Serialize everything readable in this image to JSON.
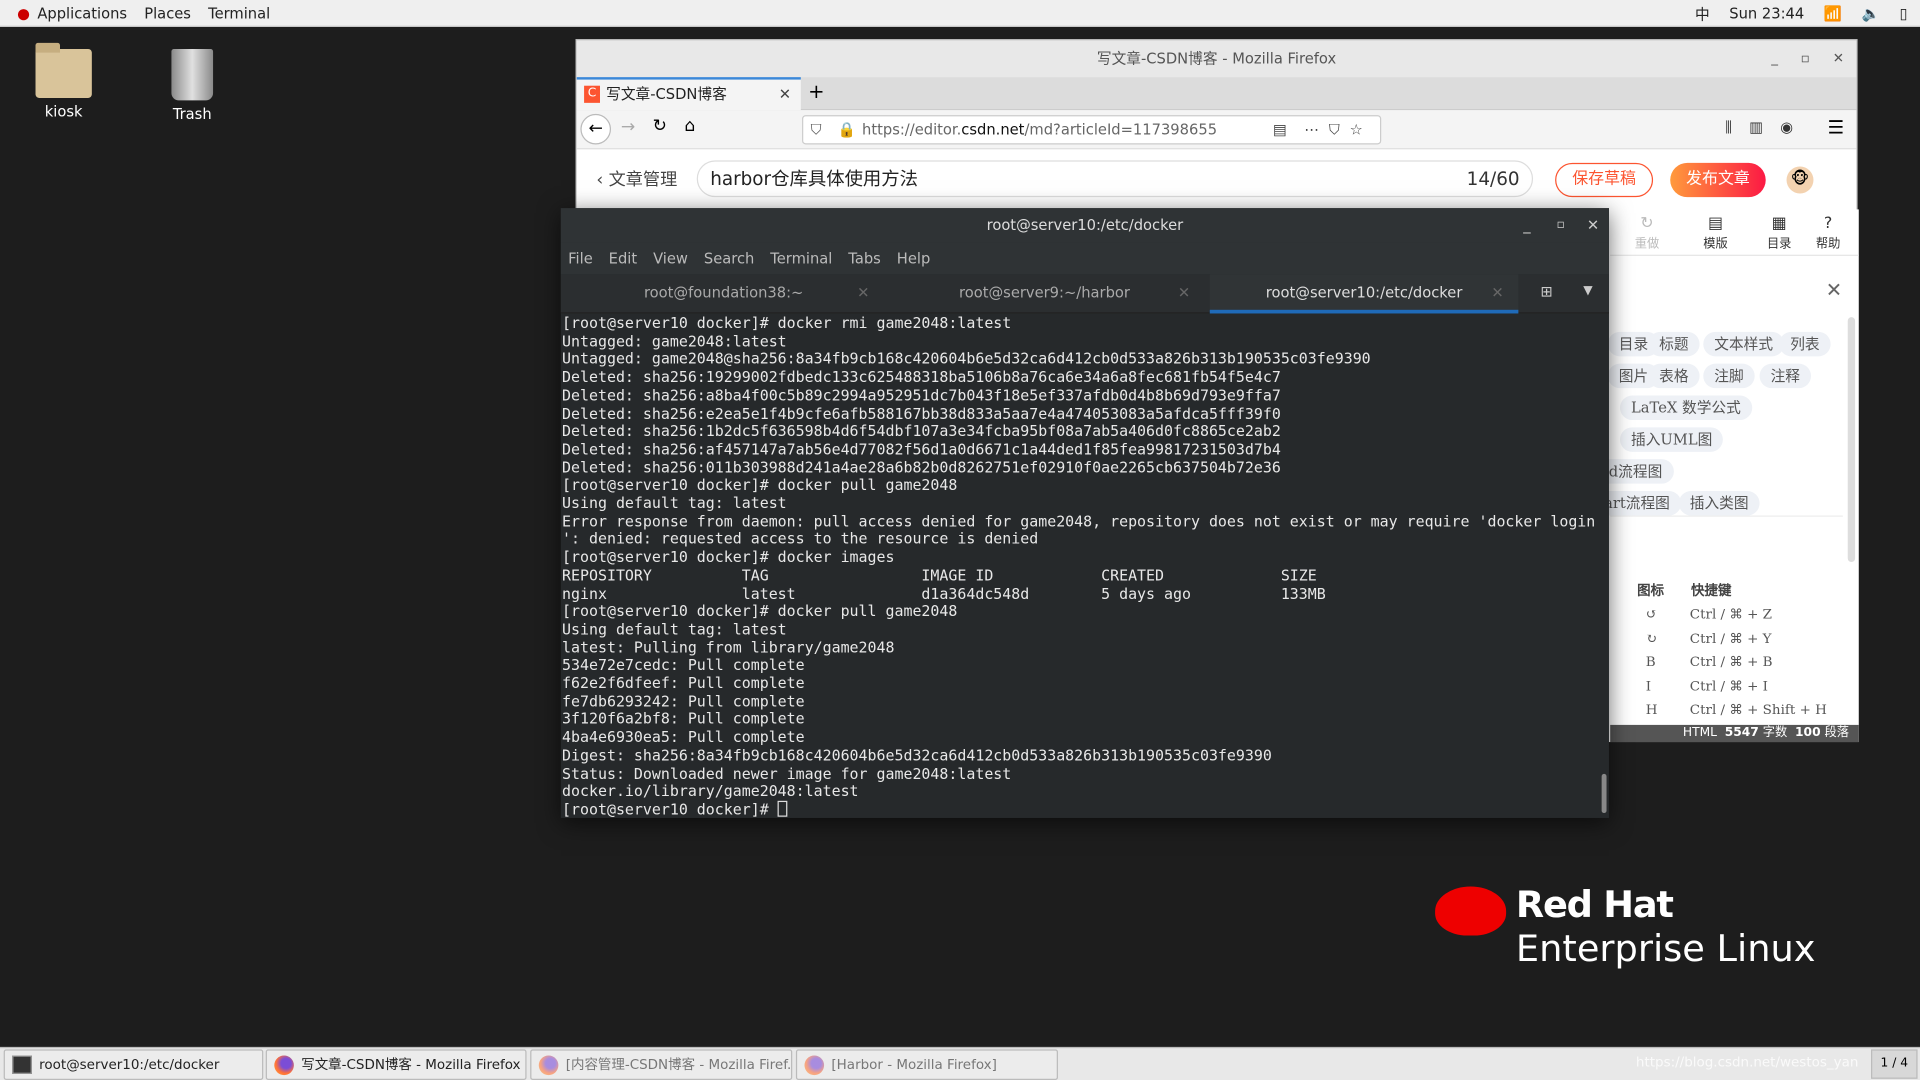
{
  "topbar": {
    "applications": "Applications",
    "places": "Places",
    "terminal": "Terminal",
    "input_method": "中",
    "clock": "Sun 23:44"
  },
  "desktop": {
    "icons": [
      {
        "label": "kiosk"
      },
      {
        "label": "Trash"
      }
    ]
  },
  "firefox": {
    "window_title": "写文章-CSDN博客 - Mozilla Firefox",
    "tab_title": "写文章-CSDN博客",
    "new_tab": "+",
    "url_prefix": "https://editor.",
    "url_domain": "csdn.net",
    "url_suffix": "/md?articleId=117398655",
    "editor": {
      "back_label": "文章管理",
      "title_value": "harbor仓库具体使用方法",
      "char_count": "14/60",
      "save_draft": "保存草稿",
      "publish": "发布文章",
      "toolbar": [
        {
          "label": "重做"
        },
        {
          "label": "模版"
        },
        {
          "label": "目录"
        },
        {
          "label": "帮助"
        }
      ],
      "chips": [
        "目录",
        "标题",
        "文本样式",
        "列表",
        "图片",
        "表格",
        "注脚",
        "注释",
        "LaTeX 数学公式",
        "插入UML图",
        "id流程图",
        "art流程图",
        "插入类图"
      ],
      "shortcut_header": {
        "icon": "图标",
        "key": "快捷键"
      },
      "shortcuts": [
        {
          "icon": "↺",
          "key": "Ctrl / ⌘ + Z"
        },
        {
          "icon": "↻",
          "key": "Ctrl / ⌘ + Y"
        },
        {
          "icon": "B",
          "key": "Ctrl / ⌘ + B"
        },
        {
          "icon": "I",
          "key": "Ctrl / ⌘ + I"
        },
        {
          "icon": "H",
          "key": "Ctrl / ⌘ + Shift + H"
        }
      ],
      "status": {
        "mode": "HTML",
        "words": "5547",
        "words_unit": "字数",
        "paras": "100",
        "paras_unit": "段落"
      }
    }
  },
  "terminal": {
    "title": "root@server10:/etc/docker",
    "menu": [
      "File",
      "Edit",
      "View",
      "Search",
      "Terminal",
      "Tabs",
      "Help"
    ],
    "tabs": [
      {
        "label": "root@foundation38:~"
      },
      {
        "label": "root@server9:~/harbor"
      },
      {
        "label": "root@server10:/etc/docker",
        "active": true
      }
    ],
    "lines": [
      "[root@server10 docker]# docker rmi game2048:latest",
      "Untagged: game2048:latest",
      "Untagged: game2048@sha256:8a34fb9cb168c420604b6e5d32ca6d412cb0d533a826b313b190535c03fe9390",
      "Deleted: sha256:19299002fdbedc133c625488318ba5106b8a76ca6e34a6a8fec681fb54f5e4c7",
      "Deleted: sha256:a8ba4f00c5b89c2994a952951dc7b043f18e5ef337afdb0d4b8b69d793e9ffa7",
      "Deleted: sha256:e2ea5e1f4b9cfe6afb588167bb38d833a5aa7e4a474053083a5afdca5fff39f0",
      "Deleted: sha256:1b2dc5f636598b4d6f54dbf107a3e34fcba95bf08a7ab5a406d0fc8865ce2ab2",
      "Deleted: sha256:af457147a7ab56e4d77082f56d1a0d6671c1a44ded1f85fea99817231503d7b4",
      "Deleted: sha256:011b303988d241a4ae28a6b82b0d8262751ef02910f0ae2265cb637504b72e36",
      "[root@server10 docker]# docker pull game2048",
      "Using default tag: latest",
      "Error response from daemon: pull access denied for game2048, repository does not exist or may require 'docker login",
      "': denied: requested access to the resource is denied",
      "[root@server10 docker]# docker images",
      "REPOSITORY          TAG                 IMAGE ID            CREATED             SIZE",
      "nginx               latest              d1a364dc548d        5 days ago          133MB",
      "[root@server10 docker]# docker pull game2048",
      "Using default tag: latest",
      "latest: Pulling from library/game2048",
      "534e72e7cedc: Pull complete",
      "f62e2f6dfeef: Pull complete",
      "fe7db6293242: Pull complete",
      "3f120f6a2bf8: Pull complete",
      "4ba4e6930ea5: Pull complete",
      "Digest: sha256:8a34fb9cb168c420604b6e5d32ca6d412cb0d533a826b313b190535c03fe9390",
      "Status: Downloaded newer image for game2048:latest",
      "docker.io/library/game2048:latest"
    ],
    "prompt": "[root@server10 docker]# "
  },
  "branding": {
    "line1": "Red Hat",
    "line2": "Enterprise Linux"
  },
  "taskbar": {
    "items": [
      {
        "label": "root@server10:/etc/docker"
      },
      {
        "label": "写文章-CSDN博客 - Mozilla Firefox"
      },
      {
        "label": "[内容管理-CSDN博客 - Mozilla Firef..."
      },
      {
        "label": "[Harbor - Mozilla Firefox]"
      }
    ],
    "watermark": "https://blog.csdn.net/westos_yan",
    "workspace": "1 / 4"
  },
  "colors": {
    "accent": "#fc5531",
    "terminal_bg": "#26292b",
    "redhat": "#ee0000"
  }
}
